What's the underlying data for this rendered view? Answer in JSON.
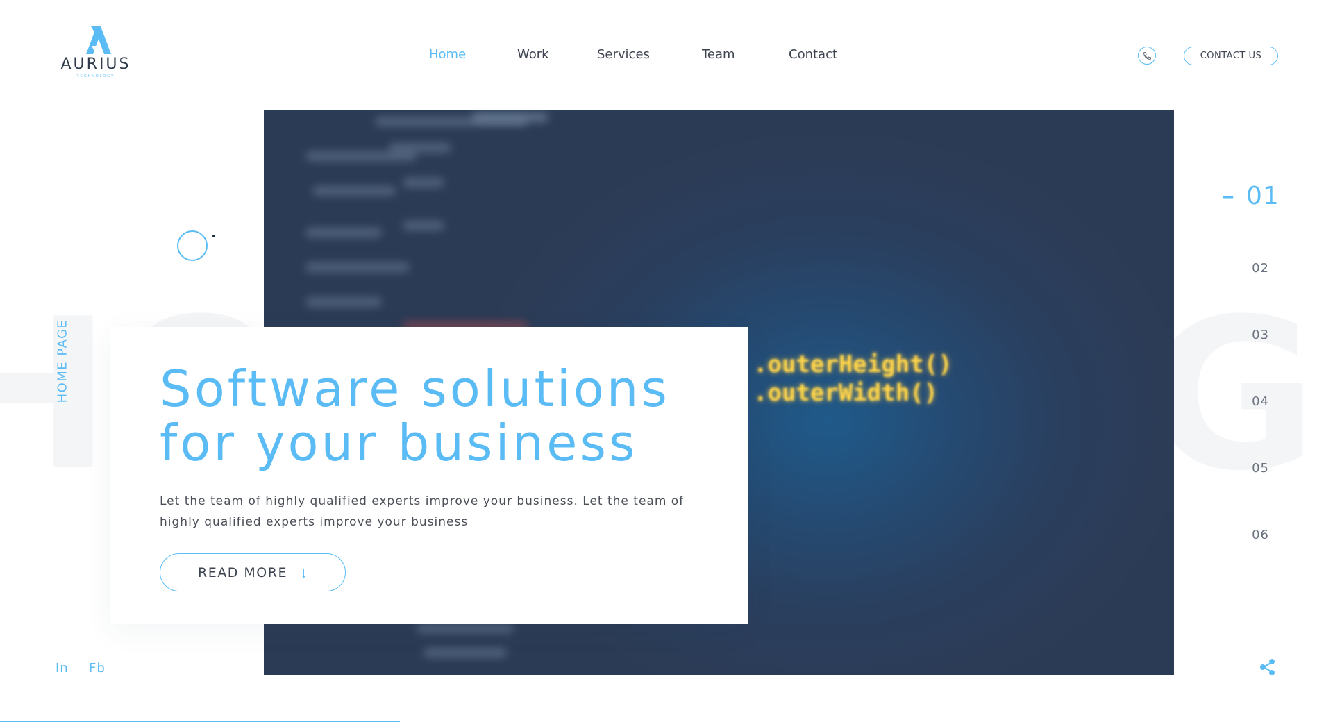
{
  "brand": {
    "name": "AURIUS",
    "tagline": "TECHNOLOGY",
    "accent_color": "#5bbcf5",
    "text_color": "#3d4450"
  },
  "nav": {
    "items": [
      {
        "label": "Home",
        "active": true
      },
      {
        "label": "Work",
        "active": false
      },
      {
        "label": "Services",
        "active": false
      },
      {
        "label": "Team",
        "active": false
      },
      {
        "label": "Contact",
        "active": false
      }
    ]
  },
  "header": {
    "phone_icon": "phone-icon",
    "contact_label": "CONTACT US"
  },
  "side": {
    "vertical_label": "HOME PAGE"
  },
  "background_word": {
    "left": "HO",
    "right": "GI"
  },
  "hero": {
    "code_lines": [
      ".outerHeight()",
      ".outerWidth()"
    ]
  },
  "card": {
    "title": "Software solutions for your business",
    "description": "Let the team of highly qualified experts improve your business. Let the team of highly qualified experts improve your business",
    "button_label": "READ MORE",
    "button_icon": "arrow-down-icon"
  },
  "slides": {
    "dash": "–",
    "items": [
      "01",
      "02",
      "03",
      "04",
      "05",
      "06"
    ],
    "active_index": 0
  },
  "social": {
    "linkedin": "In",
    "facebook": "Fb"
  },
  "share": {
    "icon": "share-icon"
  },
  "progress": {
    "fraction": 0.3
  }
}
